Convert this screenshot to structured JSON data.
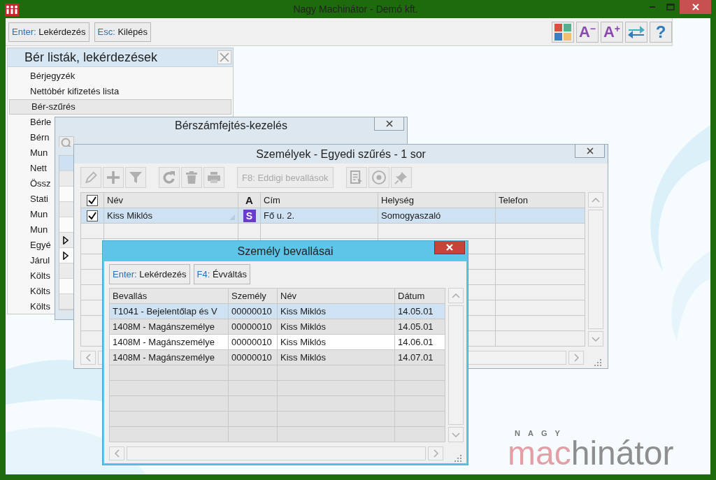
{
  "window": {
    "title": "Nagy Machinátor - Demó kft."
  },
  "toolbar": {
    "buttons": [
      {
        "key": "Enter:",
        "label": "Lekérdezés"
      },
      {
        "key": "Esc:",
        "label": "Kilépés"
      }
    ],
    "tools": [
      {
        "kind": "palette"
      },
      {
        "kind": "font_smaller",
        "glyph": "A",
        "sign": "−"
      },
      {
        "kind": "font_larger",
        "glyph": "A",
        "sign": "+"
      },
      {
        "kind": "swap"
      },
      {
        "kind": "help",
        "glyph": "?"
      }
    ]
  },
  "list_window": {
    "title": "Bér listák, lekérdezések",
    "items": [
      {
        "label": "Bérjegyzék",
        "selected": false
      },
      {
        "label": "Nettóbér kifizetés lista",
        "selected": false
      },
      {
        "label": "Bér-szűrés",
        "selected": true
      },
      {
        "label": "Bérle",
        "selected": false
      },
      {
        "label": "Bérn",
        "selected": false
      },
      {
        "label": "Mun",
        "selected": false
      },
      {
        "label": "Nett",
        "selected": false
      },
      {
        "label": "Össz",
        "selected": false
      },
      {
        "label": "Stati",
        "selected": false
      },
      {
        "label": "Mun",
        "selected": false
      },
      {
        "label": "Mun",
        "selected": false
      },
      {
        "label": "Egyé",
        "selected": false
      },
      {
        "label": "Járul",
        "selected": false
      },
      {
        "label": "Költs",
        "selected": false
      },
      {
        "label": "Költs",
        "selected": false
      },
      {
        "label": "Költs",
        "selected": false
      }
    ]
  },
  "payroll_window": {
    "title": "Bérszámfejtés-kezelés",
    "rows": [
      {
        "selected": true,
        "pointer": false
      },
      {
        "selected": false,
        "pointer": false
      },
      {
        "selected": false,
        "pointer": false
      },
      {
        "selected": false,
        "pointer": false
      },
      {
        "selected": false,
        "pointer": false
      },
      {
        "selected": false,
        "pointer": true
      },
      {
        "selected": false,
        "pointer": true
      },
      {
        "selected": false,
        "pointer": false
      },
      {
        "selected": false,
        "pointer": false
      },
      {
        "selected": false,
        "pointer": false
      }
    ]
  },
  "persons_window": {
    "title": "Személyek - Egyedi szűrés - 1 sor",
    "tools": [
      {
        "kind": "pencil"
      },
      {
        "kind": "plus"
      },
      {
        "kind": "filter"
      },
      {
        "kind": "gap"
      },
      {
        "kind": "refresh"
      },
      {
        "kind": "trash"
      },
      {
        "kind": "print"
      },
      {
        "kind": "gap"
      },
      {
        "kind": "button",
        "key": "F8:",
        "label": "Eddigi bevallások",
        "disabled": true
      },
      {
        "kind": "gap"
      },
      {
        "kind": "document"
      },
      {
        "kind": "eye"
      },
      {
        "kind": "pin"
      }
    ],
    "table": {
      "all_checked": true,
      "columns": [
        {
          "label": "Név",
          "kind": "text"
        },
        {
          "label": "A",
          "kind": "flag"
        },
        {
          "label": "Cím",
          "kind": "text"
        },
        {
          "label": "Helység",
          "kind": "text"
        },
        {
          "label": "Telefon",
          "kind": "text"
        }
      ],
      "rows": [
        {
          "checked": true,
          "selected": true,
          "name": "Kiss Miklós",
          "badge": "S",
          "address": "Fő u. 2.",
          "city": "Somogyaszaló"
        }
      ]
    }
  },
  "declarations_window": {
    "title": "Személy bevallásai",
    "buttons": [
      {
        "key": "Enter:",
        "label": "Lekérdezés"
      },
      {
        "key": "F4:",
        "label": "Évváltás"
      }
    ],
    "columns": [
      "Bevallás",
      "Személy",
      "Név",
      "Dátum"
    ],
    "rows": [
      {
        "cells": [
          "T1041 - Bejelentőlap és V",
          "00000010",
          "Kiss Miklós",
          "14.05.01"
        ],
        "selected": true,
        "focused": false
      },
      {
        "cells": [
          "1408M - Magánszemélye",
          "00000010",
          "Kiss Miklós",
          "14.05.01"
        ],
        "selected": false,
        "focused": false
      },
      {
        "cells": [
          "1408M - Magánszemélye",
          "00000010",
          "Kiss Miklós",
          "14.06.01"
        ],
        "selected": false,
        "focused": true
      },
      {
        "cells": [
          "1408M - Magánszemélye",
          "00000010",
          "Kiss Miklós",
          "14.07.01"
        ],
        "selected": false,
        "focused": false
      }
    ]
  },
  "logo": {
    "small": "NAGY",
    "first": "mac",
    "rest": "hinátor"
  }
}
